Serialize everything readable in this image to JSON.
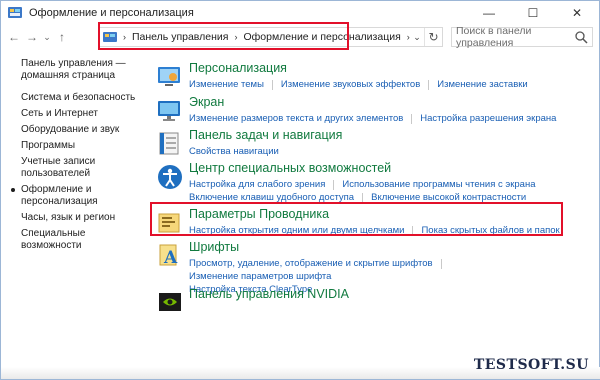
{
  "window": {
    "title": "Оформление и персонализация",
    "controls": {
      "minimize": "—",
      "maximize": "☐",
      "close": "✕"
    }
  },
  "nav": {
    "back": "←",
    "forward": "→",
    "down": "⌄",
    "up": "↑",
    "breadcrumbs": [
      "Панель управления",
      "Оформление и персонализация"
    ],
    "separator": "›",
    "dropdown": "⌄",
    "refresh": "↻",
    "search_placeholder": "Поиск в панели управления"
  },
  "sidebar": {
    "items": [
      "Панель управления —",
      "домашняя страница",
      "Система и безопасность",
      "Сеть и Интернет",
      "Оборудование и звук",
      "Программы",
      "Учетные записи",
      "пользователей",
      "Оформление и",
      "персонализация",
      "Часы, язык и регион",
      "Специальные возможности"
    ]
  },
  "categories": [
    {
      "title": "Персонализация",
      "icon": "personalization-icon",
      "links": [
        "Изменение темы",
        "Изменение звуковых эффектов",
        "Изменение заставки"
      ]
    },
    {
      "title": "Экран",
      "icon": "display-icon",
      "links": [
        "Изменение размеров текста и других элементов",
        "Настройка разрешения экрана"
      ]
    },
    {
      "title": "Панель задач и навигация",
      "icon": "taskbar-icon",
      "links": [
        "Свойства навигации"
      ]
    },
    {
      "title": "Центр специальных возможностей",
      "icon": "ease-of-access-icon",
      "links": [
        "Настройка для слабого зрения",
        "Использование программы чтения с экрана",
        "Включение клавиш удобного доступа",
        "Включение высокой контрастности"
      ]
    },
    {
      "title": "Параметры Проводника",
      "icon": "folder-options-icon",
      "links": [
        "Настройка открытия одним или двумя щелчками",
        "Показ скрытых файлов и папок"
      ]
    },
    {
      "title": "Шрифты",
      "icon": "fonts-icon",
      "links": [
        "Просмотр, удаление, отображение и скрытие шрифтов",
        "Изменение параметров шрифта",
        "Настройка текста ClearType"
      ]
    },
    {
      "title": "Панель управления NVIDIA",
      "icon": "nvidia-icon",
      "links": []
    }
  ],
  "watermark": "TESTSOFT.SU",
  "colors": {
    "link": "#1a5fb4",
    "category": "#117a3f",
    "highlight": "#e2102a"
  }
}
